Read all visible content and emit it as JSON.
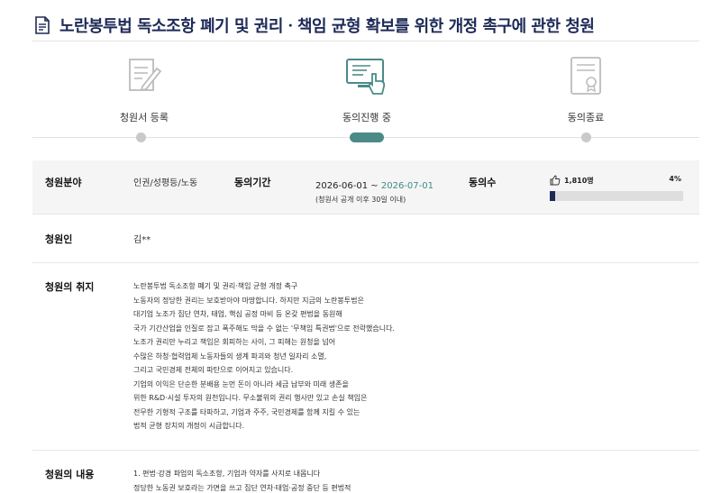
{
  "title": "노란봉투법 독소조항 폐기 및 권리ㆍ책임 균형 확보를 위한 개정 촉구에 관한 청원",
  "steps": [
    {
      "label": "청원서 등록",
      "icon": "document-pen-icon",
      "active": false
    },
    {
      "label": "동의진행 중",
      "icon": "monitor-hand-icon",
      "active": true
    },
    {
      "label": "동의종료",
      "icon": "certificate-icon",
      "active": false
    }
  ],
  "info": {
    "field_label": "청원분야",
    "field_value": "인권/성평등/노동",
    "period_label": "동의기간",
    "period_start": "2026-06-01 ~ ",
    "period_end": "2026-07-01",
    "period_note": "(청원서 공개 이후 30일 이내)",
    "agree_label": "동의수",
    "agree_count": "1,810명",
    "agree_percent": "4%",
    "agree_fraction": 0.04,
    "petitioner_label": "청원인",
    "petitioner_value": "김**"
  },
  "purpose": {
    "label": "청원의 취지",
    "lines": [
      "노란봉투법 독소조항 폐기 및 권리·책임 균형 개정 촉구",
      "노동자의 정당한 권리는 보호받아야 마땅합니다. 하지만 지금의 노란봉투법은",
      "대기업 노조가 집단 연차, 태업, 핵심 공정 마비 등 온갖 편법을 동원해",
      "국가 기간산업을 인질로 잡고 폭주해도 막을 수 없는 '무책임 특권법'으로 전락했습니다.",
      "노조가 권리만 누리고 책임은 회피하는 사이, 그 피해는 원청을 넘어",
      "수많은 하청·협력업체 노동자들의 생계 파괴와 청년 일자리 소멸,",
      "그리고 국민경제 전체의 파탄으로 이어지고 있습니다.",
      "기업의 이익은 단순한 분배용 눈먼 돈이 아니라 세금 납부와 미래 생존을",
      "위한 R&D·시설 투자의 원천입니다. 무소불위의 권리 행사만 있고 손실 책임은",
      "전무한 기형적 구조를 타파하고, 기업과 주주, 국민경제를 함께 지킬 수 있는",
      "법적 균형 장치의 개정이 시급합니다."
    ]
  },
  "content": {
    "label": "청원의 내용",
    "lines": [
      "1. 편법·강경 파업의 독소조항, 기업과 약자를 사지로 내몹니다",
      "정당한 노동권 보호라는 가면을 쓰고 집단 연차·태업·공정 중단 등 편법적"
    ]
  }
}
